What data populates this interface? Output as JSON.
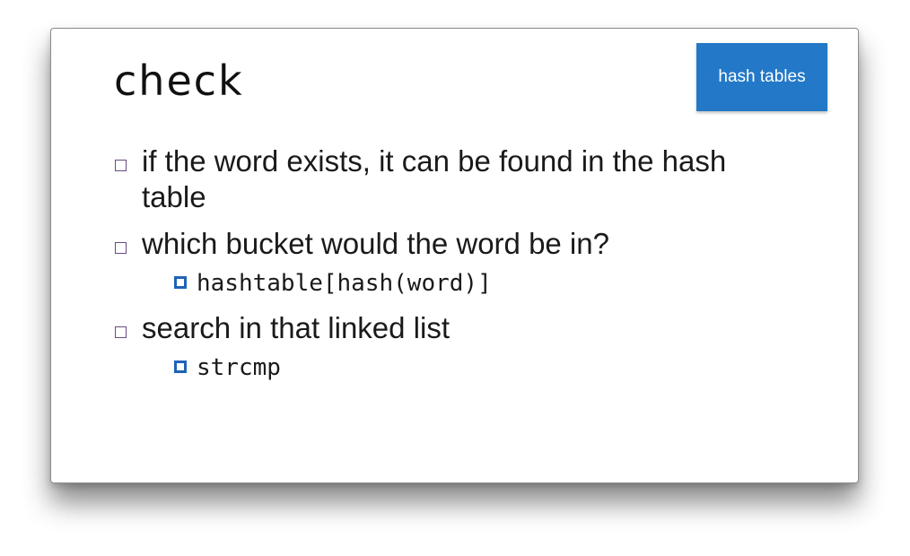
{
  "slide": {
    "title": "check",
    "tag_label": "hash tables",
    "bullets": [
      {
        "text": "if the word exists, it can be found in the hash table",
        "sub": []
      },
      {
        "text": "which bucket would the word be in?",
        "sub": [
          "hashtable[hash(word)]"
        ]
      },
      {
        "text": "search in that linked list",
        "sub": [
          "strcmp"
        ]
      }
    ]
  },
  "colors": {
    "tag_background": "#2379c7",
    "bullet_box": "#6b4a82",
    "sub_bullet_box": "#1f63b8"
  },
  "icons": {
    "bullet": "hollow-square-icon",
    "sub_bullet": "filled-square-outline-icon"
  }
}
